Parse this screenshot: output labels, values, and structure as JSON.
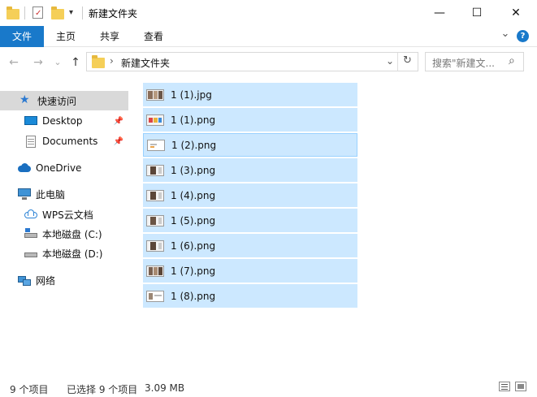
{
  "window": {
    "title": "新建文件夹",
    "minimize": "—",
    "maximize": "☐",
    "close": "✕"
  },
  "ribbon": {
    "tabs": [
      "文件",
      "主页",
      "共享",
      "查看"
    ],
    "expand": "⌄",
    "help": "?"
  },
  "nav": {
    "back": "←",
    "forward": "→",
    "recent": "⌄",
    "up": "↑",
    "address_sep": "›",
    "address": "新建文件夹",
    "dropdown": "⌄",
    "refresh": "↻",
    "search_placeholder": "搜索\"新建文...",
    "search_icon": "⌕"
  },
  "sidebar": {
    "items": [
      {
        "label": "快速访问",
        "icon": "star-icon"
      },
      {
        "label": "Desktop",
        "icon": "desktop-icon",
        "pinned": true
      },
      {
        "label": "Documents",
        "icon": "documents-icon",
        "pinned": true
      },
      {
        "label": "OneDrive",
        "icon": "cloud-icon"
      },
      {
        "label": "此电脑",
        "icon": "computer-icon"
      },
      {
        "label": "WPS云文档",
        "icon": "wps-cloud-icon"
      },
      {
        "label": "本地磁盘 (C:)",
        "icon": "drive-icon"
      },
      {
        "label": "本地磁盘 (D:)",
        "icon": "drive-icon"
      },
      {
        "label": "网络",
        "icon": "network-icon"
      }
    ]
  },
  "files": [
    {
      "name": "1 (1).jpg"
    },
    {
      "name": "1 (1).png"
    },
    {
      "name": "1 (2).png"
    },
    {
      "name": "1 (3).png"
    },
    {
      "name": "1 (4).png"
    },
    {
      "name": "1 (5).png"
    },
    {
      "name": "1 (6).png"
    },
    {
      "name": "1 (7).png"
    },
    {
      "name": "1 (8).png"
    }
  ],
  "status": {
    "count": "9 个项目",
    "selected": "已选择 9 个项目",
    "size": "3.09 MB"
  },
  "colors": {
    "accent": "#1979ca",
    "selection": "#cce8ff",
    "folder": "#f5cf58"
  }
}
